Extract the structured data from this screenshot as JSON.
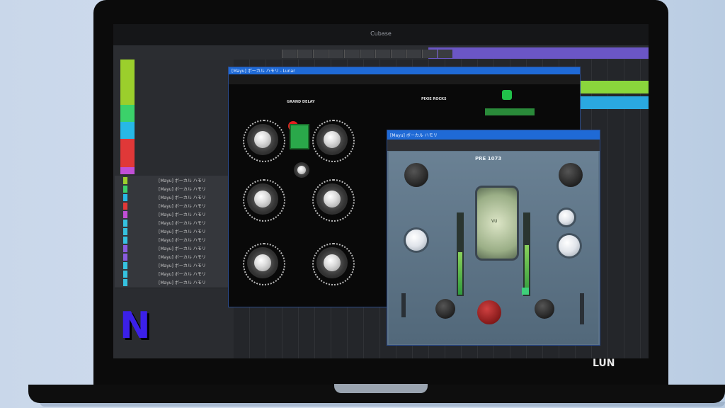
{
  "app": {
    "window_title": "Cubase",
    "accent_purple": "#6b56c6",
    "accent_blue": "#1f6ad6"
  },
  "tracks": [
    {
      "label": "[Mayu] ボーカル ハモリ",
      "color": "#9bcf2c"
    },
    {
      "label": "[Mayu] ボーカル ハモリ",
      "color": "#3bd16a"
    },
    {
      "label": "[Mayu] ボーカル ハモリ",
      "color": "#27b8e6"
    },
    {
      "label": "[Mayu] ボーカル ハモリ",
      "color": "#e03838"
    },
    {
      "label": "[Mayu] ボーカル ハモリ",
      "color": "#c14fd6"
    },
    {
      "label": "[Mayu] ボーカル ハモリ",
      "color": "#35c2e0"
    },
    {
      "label": "[Mayu] ボーカル ハモリ",
      "color": "#35c2e0"
    },
    {
      "label": "[Mayu] ボーカル ハモリ",
      "color": "#35c2e0"
    },
    {
      "label": "[Mayu] ボーカル ハモリ",
      "color": "#8a5be0"
    },
    {
      "label": "[Mayu] ボーカル ハモリ",
      "color": "#8a5be0"
    },
    {
      "label": "[Mayu] ボーカル ハモリ",
      "color": "#35c2e0"
    },
    {
      "label": "[Mayu] ボーカル ハモリ",
      "color": "#35c2e0"
    },
    {
      "label": "[Mayu] ボーカル ハモリ",
      "color": "#35c2e0"
    }
  ],
  "plugin_left": {
    "title": "[Mayu] ボーカル ハモリ - Lunar",
    "header": "GRAND DELAY",
    "logo": "LUN",
    "section": "PIXIE ROCKS"
  },
  "plugin_right": {
    "title": "[Mayu] ボーカル ハモリ",
    "brand": "PRE 1073",
    "meter_label": "VU"
  },
  "overlay": {
    "logo_letter": "N",
    "logo_color": "#3b20e8"
  }
}
